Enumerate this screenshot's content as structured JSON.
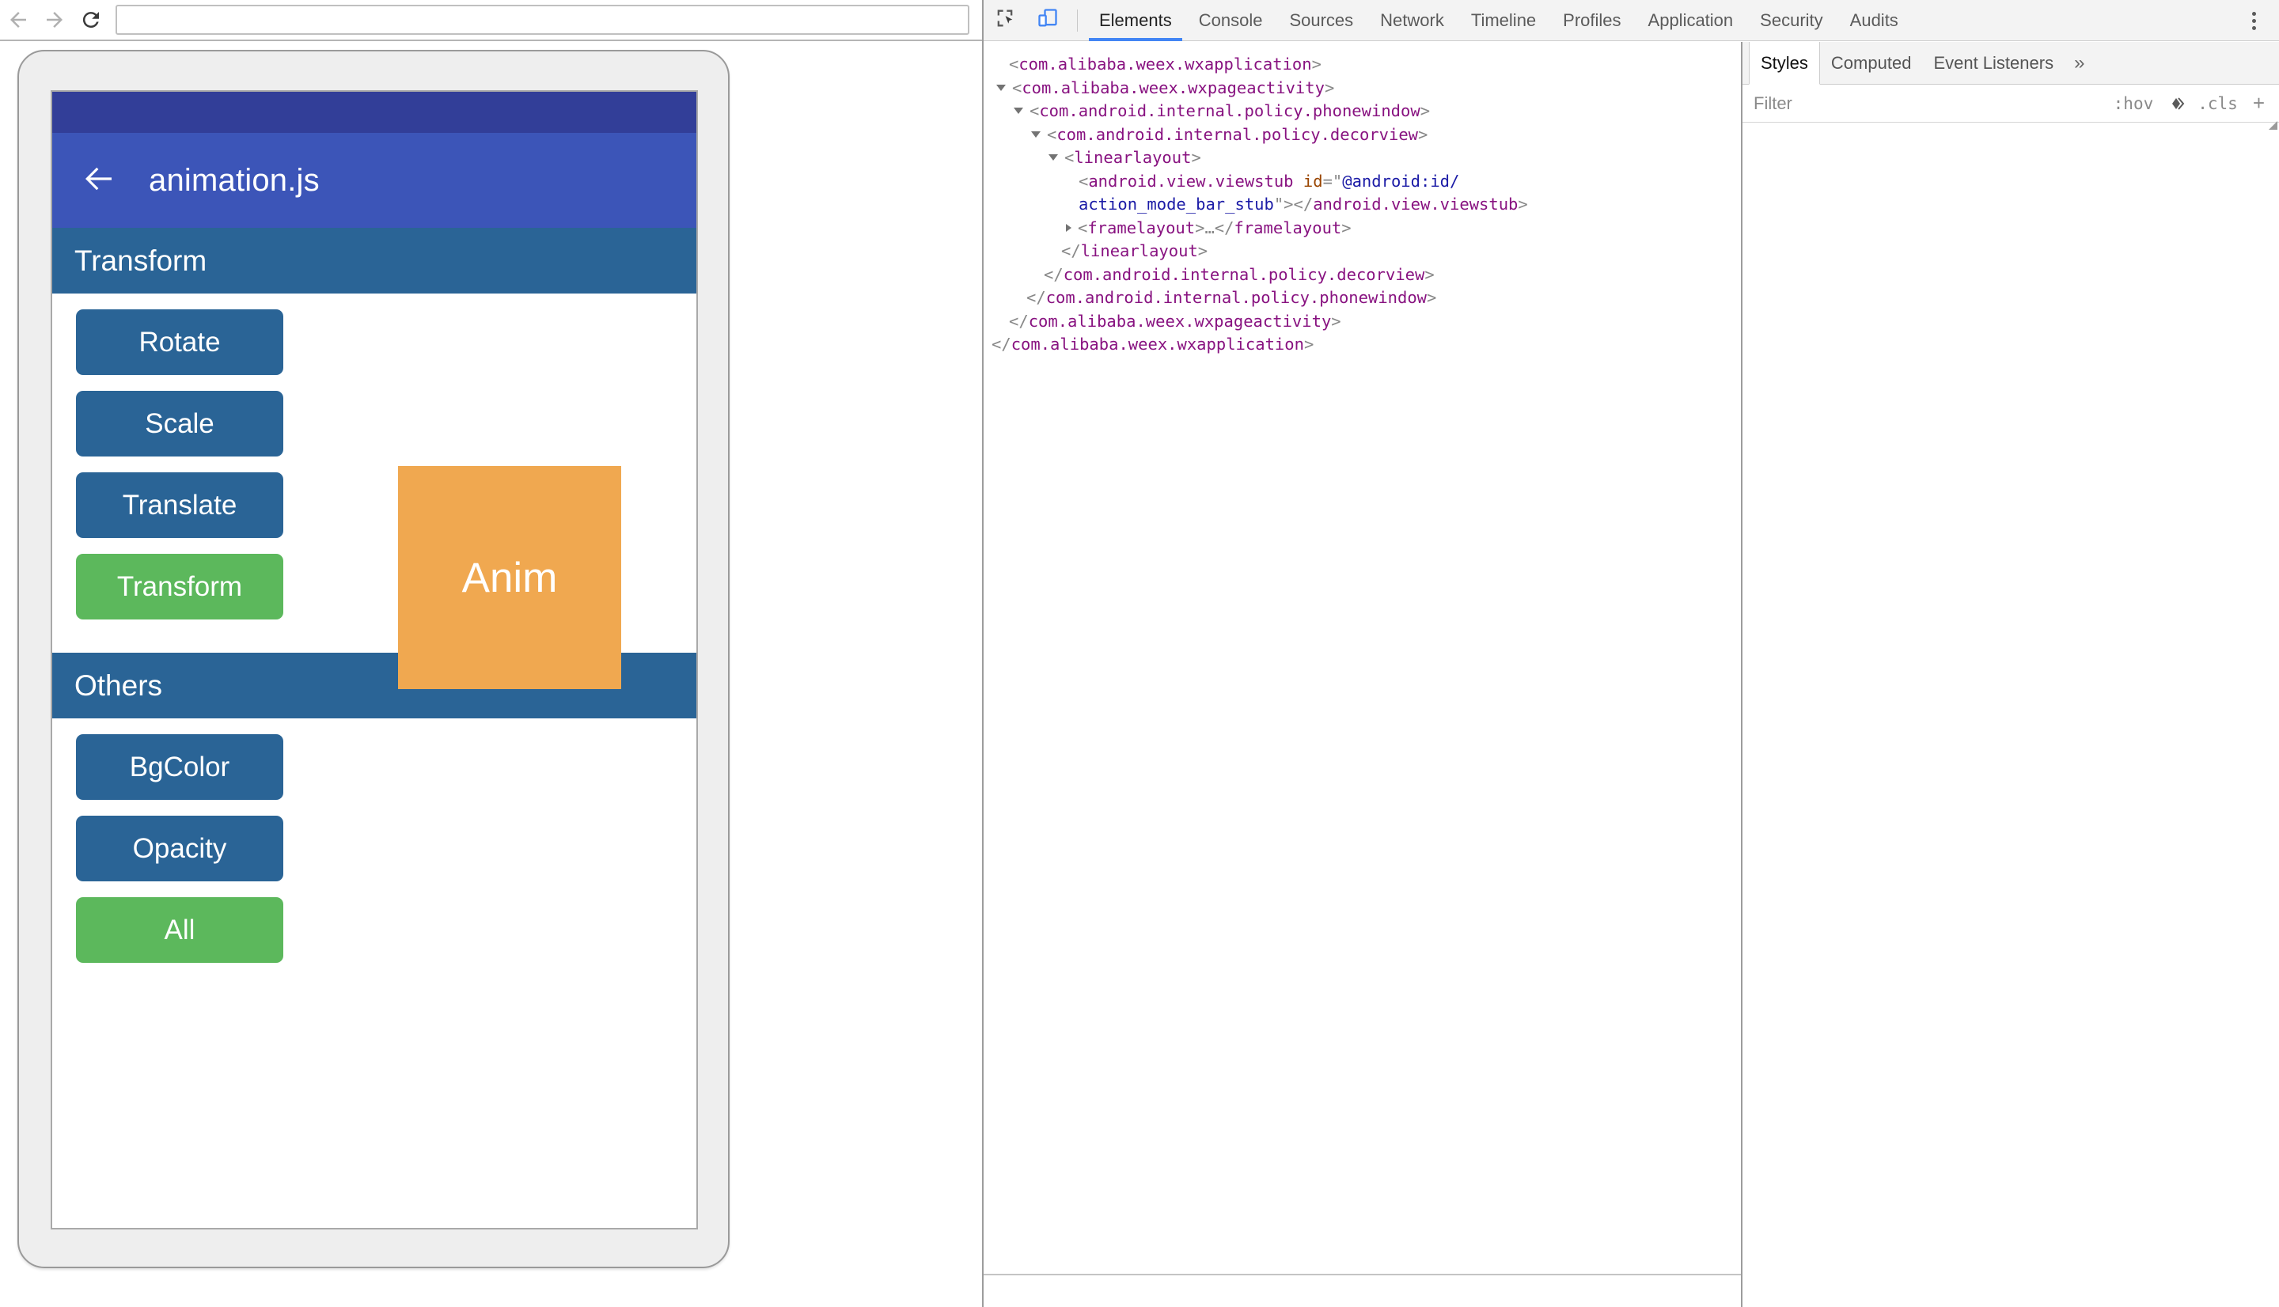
{
  "browser": {
    "back_icon": "arrow-left-icon",
    "forward_icon": "arrow-right-icon",
    "reload_icon": "reload-icon",
    "url_value": "",
    "url_placeholder": ""
  },
  "device": {
    "status_bar_color": "#323e98",
    "app_bar_color": "#3c55b8",
    "back_icon": "arrow-left-icon",
    "title": "animation.js",
    "sections": [
      {
        "header": "Transform",
        "buttons": [
          {
            "label": "Rotate",
            "style": "blue"
          },
          {
            "label": "Scale",
            "style": "blue"
          },
          {
            "label": "Translate",
            "style": "blue"
          },
          {
            "label": "Transform",
            "style": "green"
          }
        ]
      },
      {
        "header": "Others",
        "buttons": [
          {
            "label": "BgColor",
            "style": "blue"
          },
          {
            "label": "Opacity",
            "style": "blue"
          },
          {
            "label": "All",
            "style": "green"
          }
        ]
      }
    ],
    "anim_box": {
      "label": "Anim",
      "color": "#f0a850"
    },
    "colors": {
      "button_blue": "#2a6496",
      "button_green": "#5cb85c",
      "section_header": "#2a6496"
    }
  },
  "devtools": {
    "inspect_icon": "inspect-element-icon",
    "device_toggle_icon": "device-toolbar-icon",
    "device_toggle_active_color": "#4285f4",
    "tabs": [
      {
        "label": "Elements",
        "active": true
      },
      {
        "label": "Console",
        "active": false
      },
      {
        "label": "Sources",
        "active": false
      },
      {
        "label": "Network",
        "active": false
      },
      {
        "label": "Timeline",
        "active": false
      },
      {
        "label": "Profiles",
        "active": false
      },
      {
        "label": "Application",
        "active": false
      },
      {
        "label": "Security",
        "active": false
      },
      {
        "label": "Audits",
        "active": false
      }
    ],
    "menu_icon": "kebab-menu-icon",
    "dom_tree": [
      {
        "indent": 0,
        "twisty": "none",
        "parts": [
          {
            "t": "punct",
            "v": "<"
          },
          {
            "t": "tag",
            "v": "com.alibaba.weex.wxapplication"
          },
          {
            "t": "punct",
            "v": ">"
          }
        ]
      },
      {
        "indent": 0,
        "twisty": "open",
        "parts": [
          {
            "t": "punct",
            "v": "<"
          },
          {
            "t": "tag",
            "v": "com.alibaba.weex.wxpageactivity"
          },
          {
            "t": "punct",
            "v": ">"
          }
        ]
      },
      {
        "indent": 1,
        "twisty": "open",
        "parts": [
          {
            "t": "punct",
            "v": "<"
          },
          {
            "t": "tag",
            "v": "com.android.internal.policy.phonewindow"
          },
          {
            "t": "punct",
            "v": ">"
          }
        ]
      },
      {
        "indent": 2,
        "twisty": "open",
        "parts": [
          {
            "t": "punct",
            "v": "<"
          },
          {
            "t": "tag",
            "v": "com.android.internal.policy.decorview"
          },
          {
            "t": "punct",
            "v": ">"
          }
        ]
      },
      {
        "indent": 3,
        "twisty": "open",
        "parts": [
          {
            "t": "punct",
            "v": "<"
          },
          {
            "t": "tag",
            "v": "linearlayout"
          },
          {
            "t": "punct",
            "v": ">"
          }
        ]
      },
      {
        "indent": 4,
        "twisty": "none",
        "parts": [
          {
            "t": "punct",
            "v": "<"
          },
          {
            "t": "tag",
            "v": "android.view.viewstub"
          },
          {
            "t": "punct",
            "v": " "
          },
          {
            "t": "attr-name",
            "v": "id"
          },
          {
            "t": "punct",
            "v": "=\""
          },
          {
            "t": "attr-value",
            "v": "@android:id/"
          }
        ]
      },
      {
        "indent": 4,
        "twisty": "none",
        "nomark": true,
        "parts": [
          {
            "t": "attr-value",
            "v": "action_mode_bar_stub"
          },
          {
            "t": "punct",
            "v": "\">"
          },
          {
            "t": "punct",
            "v": "</"
          },
          {
            "t": "tag",
            "v": "android.view.viewstub"
          },
          {
            "t": "punct",
            "v": ">"
          }
        ]
      },
      {
        "indent": 4,
        "twisty": "closed",
        "parts": [
          {
            "t": "punct",
            "v": "<"
          },
          {
            "t": "tag",
            "v": "framelayout"
          },
          {
            "t": "punct",
            "v": ">"
          },
          {
            "t": "punct",
            "v": "…"
          },
          {
            "t": "punct",
            "v": "</"
          },
          {
            "t": "tag",
            "v": "framelayout"
          },
          {
            "t": "punct",
            "v": ">"
          }
        ]
      },
      {
        "indent": 3,
        "twisty": "none",
        "parts": [
          {
            "t": "punct",
            "v": "</"
          },
          {
            "t": "tag",
            "v": "linearlayout"
          },
          {
            "t": "punct",
            "v": ">"
          }
        ]
      },
      {
        "indent": 2,
        "twisty": "none",
        "parts": [
          {
            "t": "punct",
            "v": "</"
          },
          {
            "t": "tag",
            "v": "com.android.internal.policy.decorview"
          },
          {
            "t": "punct",
            "v": ">"
          }
        ]
      },
      {
        "indent": 1,
        "twisty": "none",
        "parts": [
          {
            "t": "punct",
            "v": "</"
          },
          {
            "t": "tag",
            "v": "com.android.internal.policy.phonewindow"
          },
          {
            "t": "punct",
            "v": ">"
          }
        ]
      },
      {
        "indent": 0,
        "twisty": "none",
        "parts": [
          {
            "t": "punct",
            "v": "</"
          },
          {
            "t": "tag",
            "v": "com.alibaba.weex.wxpageactivity"
          },
          {
            "t": "punct",
            "v": ">"
          }
        ]
      },
      {
        "indent": -1,
        "twisty": "none",
        "parts": [
          {
            "t": "punct",
            "v": "</"
          },
          {
            "t": "tag",
            "v": "com.alibaba.weex.wxapplication"
          },
          {
            "t": "punct",
            "v": ">"
          }
        ]
      }
    ],
    "sidebar": {
      "tabs": [
        {
          "label": "Styles",
          "active": true
        },
        {
          "label": "Computed",
          "active": false
        },
        {
          "label": "Event Listeners",
          "active": false
        }
      ],
      "more_label": "»",
      "filter_placeholder": "Filter",
      "hov_label": ":hov",
      "color_swatch_icon": "color-picker-diamond-icon",
      "cls_label": ".cls",
      "new_rule_label": "+"
    }
  }
}
